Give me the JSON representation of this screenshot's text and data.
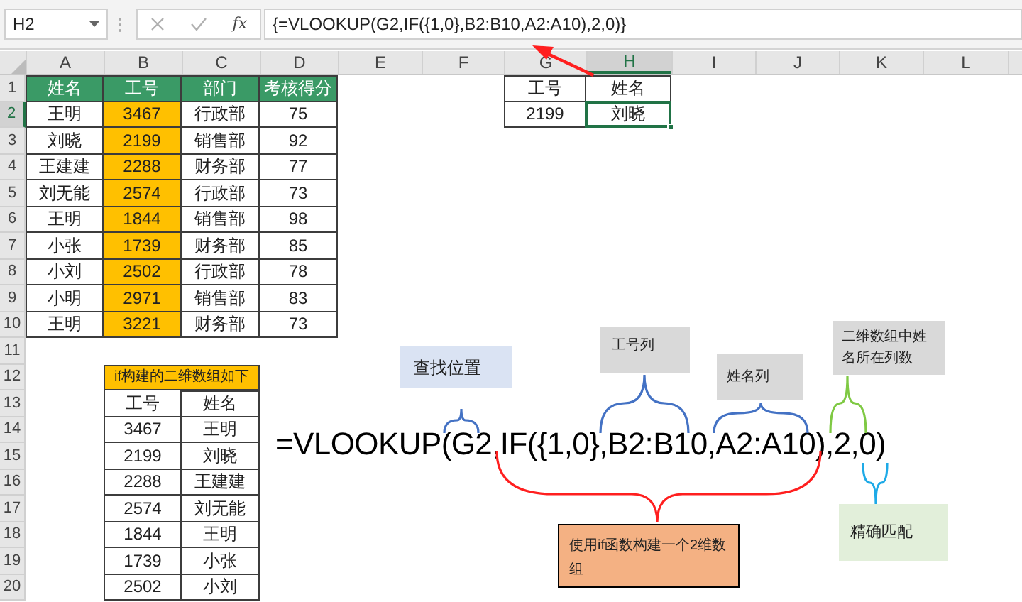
{
  "name_box": {
    "value": "H2"
  },
  "formula_bar": {
    "function_label": "fx",
    "formula": "{=VLOOKUP(G2,IF({1,0},B2:B10,A2:A10),2,0)}"
  },
  "columns": [
    {
      "label": "A",
      "selected": false
    },
    {
      "label": "B",
      "selected": false
    },
    {
      "label": "C",
      "selected": false
    },
    {
      "label": "D",
      "selected": false
    },
    {
      "label": "E",
      "selected": false
    },
    {
      "label": "F",
      "selected": false
    },
    {
      "label": "G",
      "selected": false
    },
    {
      "label": "H",
      "selected": true
    },
    {
      "label": "I",
      "selected": false
    },
    {
      "label": "J",
      "selected": false
    },
    {
      "label": "K",
      "selected": false
    },
    {
      "label": "L",
      "selected": false
    }
  ],
  "sheet_rows": [
    {
      "number": "1",
      "selected": false,
      "cells": [
        {
          "text": "姓名",
          "kind": "header",
          "selected": false
        },
        {
          "text": "工号",
          "kind": "header",
          "selected": false
        },
        {
          "text": "部门",
          "kind": "header",
          "selected": false
        },
        {
          "text": "考核得分",
          "kind": "header",
          "selected": false
        },
        null,
        null,
        {
          "text": "工号",
          "kind": "plain",
          "selected": false
        },
        {
          "text": "姓名",
          "kind": "plain",
          "selected": false
        },
        null,
        null,
        null,
        null
      ]
    },
    {
      "number": "2",
      "selected": true,
      "cells": [
        {
          "text": "王明",
          "kind": "plain",
          "selected": false
        },
        {
          "text": "3467",
          "kind": "key",
          "selected": false
        },
        {
          "text": "行政部",
          "kind": "plain",
          "selected": false
        },
        {
          "text": "75",
          "kind": "plain",
          "selected": false
        },
        null,
        null,
        {
          "text": "2199",
          "kind": "plain",
          "selected": false
        },
        {
          "text": "刘晓",
          "kind": "plain",
          "selected": true
        },
        null,
        null,
        null,
        null
      ]
    },
    {
      "number": "3",
      "selected": false,
      "cells": [
        {
          "text": "刘晓",
          "kind": "plain",
          "selected": false
        },
        {
          "text": "2199",
          "kind": "key",
          "selected": false
        },
        {
          "text": "销售部",
          "kind": "plain",
          "selected": false
        },
        {
          "text": "92",
          "kind": "plain",
          "selected": false
        },
        null,
        null,
        null,
        null,
        null,
        null,
        null,
        null
      ]
    },
    {
      "number": "4",
      "selected": false,
      "cells": [
        {
          "text": "王建建",
          "kind": "plain",
          "selected": false
        },
        {
          "text": "2288",
          "kind": "key",
          "selected": false
        },
        {
          "text": "财务部",
          "kind": "plain",
          "selected": false
        },
        {
          "text": "77",
          "kind": "plain",
          "selected": false
        },
        null,
        null,
        null,
        null,
        null,
        null,
        null,
        null
      ]
    },
    {
      "number": "5",
      "selected": false,
      "cells": [
        {
          "text": "刘无能",
          "kind": "plain",
          "selected": false
        },
        {
          "text": "2574",
          "kind": "key",
          "selected": false
        },
        {
          "text": "行政部",
          "kind": "plain",
          "selected": false
        },
        {
          "text": "73",
          "kind": "plain",
          "selected": false
        },
        null,
        null,
        null,
        null,
        null,
        null,
        null,
        null
      ]
    },
    {
      "number": "6",
      "selected": false,
      "cells": [
        {
          "text": "王明",
          "kind": "plain",
          "selected": false
        },
        {
          "text": "1844",
          "kind": "key",
          "selected": false
        },
        {
          "text": "销售部",
          "kind": "plain",
          "selected": false
        },
        {
          "text": "98",
          "kind": "plain",
          "selected": false
        },
        null,
        null,
        null,
        null,
        null,
        null,
        null,
        null
      ]
    },
    {
      "number": "7",
      "selected": false,
      "cells": [
        {
          "text": "小张",
          "kind": "plain",
          "selected": false
        },
        {
          "text": "1739",
          "kind": "key",
          "selected": false
        },
        {
          "text": "财务部",
          "kind": "plain",
          "selected": false
        },
        {
          "text": "85",
          "kind": "plain",
          "selected": false
        },
        null,
        null,
        null,
        null,
        null,
        null,
        null,
        null
      ]
    },
    {
      "number": "8",
      "selected": false,
      "cells": [
        {
          "text": "小刘",
          "kind": "plain",
          "selected": false
        },
        {
          "text": "2502",
          "kind": "key",
          "selected": false
        },
        {
          "text": "行政部",
          "kind": "plain",
          "selected": false
        },
        {
          "text": "78",
          "kind": "plain",
          "selected": false
        },
        null,
        null,
        null,
        null,
        null,
        null,
        null,
        null
      ]
    },
    {
      "number": "9",
      "selected": false,
      "cells": [
        {
          "text": "小明",
          "kind": "plain",
          "selected": false
        },
        {
          "text": "2971",
          "kind": "key",
          "selected": false
        },
        {
          "text": "销售部",
          "kind": "plain",
          "selected": false
        },
        {
          "text": "83",
          "kind": "plain",
          "selected": false
        },
        null,
        null,
        null,
        null,
        null,
        null,
        null,
        null
      ]
    },
    {
      "number": "10",
      "selected": false,
      "cells": [
        {
          "text": "王明",
          "kind": "plain",
          "selected": false
        },
        {
          "text": "3221",
          "kind": "key",
          "selected": false
        },
        {
          "text": "财务部",
          "kind": "plain",
          "selected": false
        },
        {
          "text": "73",
          "kind": "plain",
          "selected": false
        },
        null,
        null,
        null,
        null,
        null,
        null,
        null,
        null
      ]
    },
    {
      "number": "11",
      "selected": false,
      "cells": [
        null,
        null,
        null,
        null,
        null,
        null,
        null,
        null,
        null,
        null,
        null,
        null
      ]
    },
    {
      "number": "12",
      "selected": false,
      "cells": [
        null,
        {
          "text": "if构建的二维数组如下",
          "kind": "title",
          "selected": false
        },
        null,
        null,
        null,
        null,
        null,
        null,
        null,
        null,
        null
      ]
    },
    {
      "number": "13",
      "selected": false,
      "cells": [
        null,
        {
          "text": "工号",
          "kind": "plain",
          "selected": false
        },
        {
          "text": "姓名",
          "kind": "plain",
          "selected": false
        },
        null,
        null,
        null,
        null,
        null,
        null,
        null,
        null,
        null
      ]
    },
    {
      "number": "14",
      "selected": false,
      "cells": [
        null,
        {
          "text": "3467",
          "kind": "plain",
          "selected": false
        },
        {
          "text": "王明",
          "kind": "plain",
          "selected": false
        },
        null,
        null,
        null,
        null,
        null,
        null,
        null,
        null,
        null
      ]
    },
    {
      "number": "15",
      "selected": false,
      "cells": [
        null,
        {
          "text": "2199",
          "kind": "plain",
          "selected": false
        },
        {
          "text": "刘晓",
          "kind": "plain",
          "selected": false
        },
        null,
        null,
        null,
        null,
        null,
        null,
        null,
        null,
        null
      ]
    },
    {
      "number": "16",
      "selected": false,
      "cells": [
        null,
        {
          "text": "2288",
          "kind": "plain",
          "selected": false
        },
        {
          "text": "王建建",
          "kind": "plain",
          "selected": false
        },
        null,
        null,
        null,
        null,
        null,
        null,
        null,
        null,
        null
      ]
    },
    {
      "number": "17",
      "selected": false,
      "cells": [
        null,
        {
          "text": "2574",
          "kind": "plain",
          "selected": false
        },
        {
          "text": "刘无能",
          "kind": "plain",
          "selected": false
        },
        null,
        null,
        null,
        null,
        null,
        null,
        null,
        null,
        null
      ]
    },
    {
      "number": "18",
      "selected": false,
      "cells": [
        null,
        {
          "text": "1844",
          "kind": "plain",
          "selected": false
        },
        {
          "text": "王明",
          "kind": "plain",
          "selected": false
        },
        null,
        null,
        null,
        null,
        null,
        null,
        null,
        null,
        null
      ]
    },
    {
      "number": "19",
      "selected": false,
      "cells": [
        null,
        {
          "text": "1739",
          "kind": "plain",
          "selected": false
        },
        {
          "text": "小张",
          "kind": "plain",
          "selected": false
        },
        null,
        null,
        null,
        null,
        null,
        null,
        null,
        null,
        null
      ]
    },
    {
      "number": "20",
      "selected": false,
      "cells": [
        null,
        {
          "text": "2502",
          "kind": "plain",
          "selected": false
        },
        {
          "text": "小刘",
          "kind": "plain",
          "selected": false
        },
        null,
        null,
        null,
        null,
        null,
        null,
        null,
        null,
        null
      ]
    }
  ],
  "annotation": {
    "formula": "=VLOOKUP(G2,IF({1,0},B2:B10,A2:A10),2,0)",
    "callouts": [
      {
        "text": "查找位置",
        "color": "#dae3f3"
      },
      {
        "text": "工号列",
        "color": "#d9d9d9"
      },
      {
        "text": "姓名列",
        "color": "#d9d9d9"
      },
      {
        "text": "二维数组中姓名所在列数",
        "color": "#d9d9d9"
      },
      {
        "text": "精确匹配",
        "color": "#e2efda"
      },
      {
        "text": "使用if函数构建一个2维数组",
        "color": "#f4b183"
      }
    ]
  }
}
